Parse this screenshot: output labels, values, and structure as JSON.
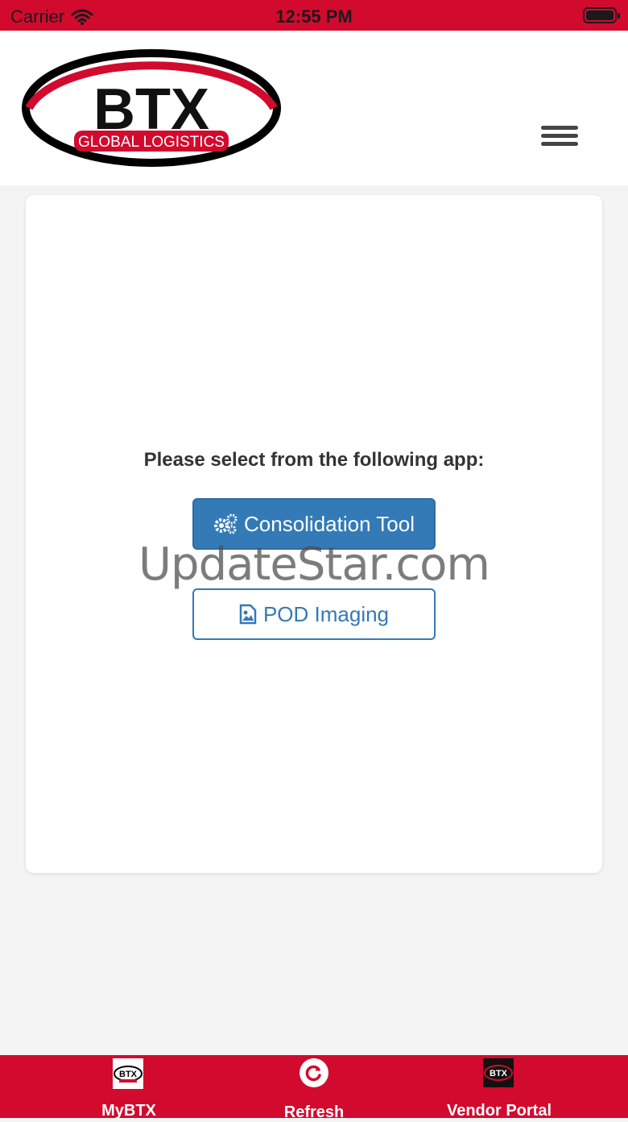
{
  "status_bar": {
    "carrier": "Carrier",
    "time": "12:55 PM"
  },
  "header": {
    "logo_text": "BTX",
    "logo_subtext": "GLOBAL LOGISTICS",
    "menu_icon": "hamburger-menu-icon"
  },
  "main": {
    "prompt": "Please select from the following app:",
    "buttons": [
      {
        "label": "Consolidation Tool",
        "icon": "gears-icon"
      },
      {
        "label": "POD Imaging",
        "icon": "image-file-icon"
      }
    ]
  },
  "watermark": "UpdateStar.com",
  "tabbar": {
    "items": [
      {
        "label": "MyBTX",
        "icon": "btx-logo-icon"
      },
      {
        "label": "Refresh",
        "icon": "refresh-icon"
      },
      {
        "label": "Vendor Portal",
        "icon": "btx-dark-logo-icon"
      }
    ]
  },
  "colors": {
    "brand_red": "#d20a2e",
    "primary_blue": "#337ab7"
  }
}
